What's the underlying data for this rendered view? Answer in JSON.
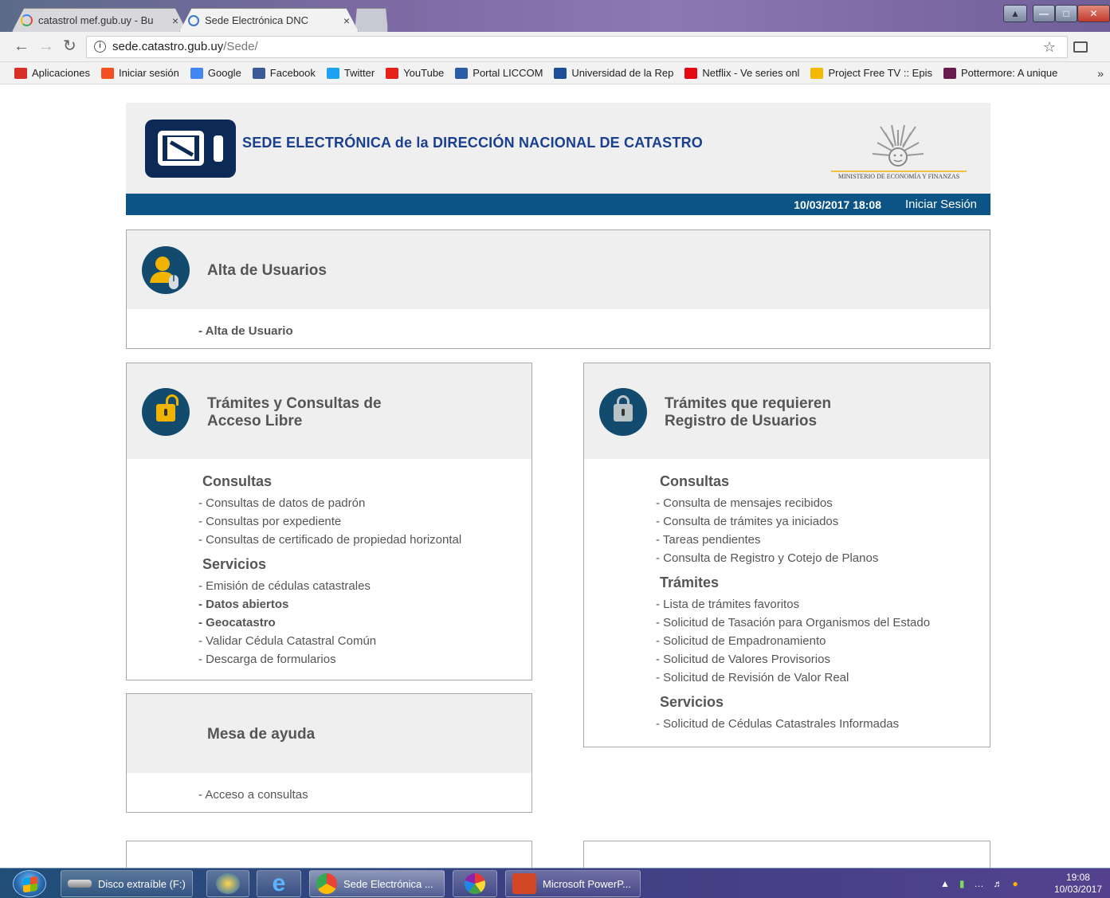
{
  "browser": {
    "tabs": [
      {
        "title": "catastrol mef.gub.uy - Bu",
        "active": false
      },
      {
        "title": "Sede Electrónica DNC",
        "active": true
      }
    ],
    "close_glyph": "×",
    "url_host": "sede.catastro.gub.uy",
    "url_path": "/Sede/",
    "bookmarks": [
      {
        "label": "Aplicaciones",
        "icon": "apps-grid-icon",
        "color": "#d93025"
      },
      {
        "label": "Iniciar sesión",
        "icon": "microsoft-icon",
        "color": "#f25022"
      },
      {
        "label": "Google",
        "icon": "google-icon",
        "color": "#4285f4"
      },
      {
        "label": "Facebook",
        "icon": "facebook-icon",
        "color": "#3b5998"
      },
      {
        "label": "Twitter",
        "icon": "twitter-icon",
        "color": "#1da1f2"
      },
      {
        "label": "YouTube",
        "icon": "youtube-icon",
        "color": "#e62117"
      },
      {
        "label": "Portal LICCOM",
        "icon": "liccom-icon",
        "color": "#2a5ca8"
      },
      {
        "label": "Universidad de la Rep",
        "icon": "university-icon",
        "color": "#1f4e99"
      },
      {
        "label": "Netflix - Ve series onl",
        "icon": "netflix-icon",
        "color": "#e50914"
      },
      {
        "label": "Project Free TV :: Epis",
        "icon": "freetv-icon",
        "color": "#f5b800"
      },
      {
        "label": "Pottermore: A unique",
        "icon": "pottermore-icon",
        "color": "#6a1b4d"
      }
    ],
    "bookmarks_more": "»"
  },
  "header": {
    "site_title": "SEDE ELECTRÓNICA de la DIRECCIÓN NACIONAL DE CATASTRO",
    "ministry": "MINISTERIO DE ECONOMÍA Y FINANZAS",
    "datetime": "10/03/2017 18:08",
    "login_label": "Iniciar Sesión"
  },
  "panels": {
    "alta": {
      "title": "Alta de Usuarios",
      "links": [
        "- Alta de Usuario"
      ]
    },
    "libre": {
      "title_line1": "Trámites y Consultas de",
      "title_line2": "Acceso Libre",
      "sections": [
        {
          "heading": "Consultas",
          "links": [
            {
              "text": "- Consultas de datos de padrón",
              "bold": false
            },
            {
              "text": "- Consultas por expediente",
              "bold": false
            },
            {
              "text": "- Consultas de certificado de propiedad horizontal",
              "bold": false
            }
          ]
        },
        {
          "heading": "Servicios",
          "links": [
            {
              "text": "- Emisión de cédulas catastrales",
              "bold": false
            },
            {
              "text": "- Datos abiertos",
              "bold": true
            },
            {
              "text": "- Geocatastro",
              "bold": true
            },
            {
              "text": "- Validar Cédula Catastral Común",
              "bold": false
            },
            {
              "text": "- Descarga de formularios",
              "bold": false
            }
          ]
        }
      ]
    },
    "registro": {
      "title_line1": "Trámites que requieren",
      "title_line2": "Registro de Usuarios",
      "sections": [
        {
          "heading": "Consultas",
          "links": [
            {
              "text": "- Consulta de mensajes recibidos",
              "bold": false
            },
            {
              "text": "- Consulta de trámites ya iniciados",
              "bold": false
            },
            {
              "text": "- Tareas pendientes",
              "bold": false
            },
            {
              "text": "- Consulta de Registro y Cotejo de Planos",
              "bold": false
            }
          ]
        },
        {
          "heading": "Trámites",
          "links": [
            {
              "text": "- Lista de trámites favoritos",
              "bold": false
            },
            {
              "text": "- Solicitud de Tasación para Organismos del Estado",
              "bold": false
            },
            {
              "text": "- Solicitud de Empadronamiento",
              "bold": false
            },
            {
              "text": "- Solicitud de Valores Provisorios",
              "bold": false
            },
            {
              "text": "- Solicitud de Revisión de Valor Real",
              "bold": false
            }
          ]
        },
        {
          "heading": "Servicios",
          "links": [
            {
              "text": "- Solicitud de Cédulas Catastrales Informadas",
              "bold": false
            }
          ]
        }
      ]
    },
    "ayuda": {
      "title": "Mesa de ayuda",
      "links": [
        "- Acceso a consultas"
      ]
    }
  },
  "taskbar": {
    "items": [
      {
        "label": "Disco extraíble (F:)",
        "icon": "usb-drive-icon"
      },
      {
        "label": "",
        "icon": "autocad-icon"
      },
      {
        "label": "",
        "icon": "internet-explorer-icon"
      },
      {
        "label": "Sede Electrónica ...",
        "icon": "chrome-icon"
      },
      {
        "label": "",
        "icon": "picasa-icon"
      },
      {
        "label": "Microsoft PowerP...",
        "icon": "powerpoint-icon"
      }
    ],
    "clock_time": "19:08",
    "clock_date": "10/03/2017"
  },
  "colors": {
    "header_bar": "#0c5486",
    "title_blue": "#1a3f8f",
    "panel_icon_bg": "#124b6e",
    "lock_gold": "#f0b400"
  }
}
